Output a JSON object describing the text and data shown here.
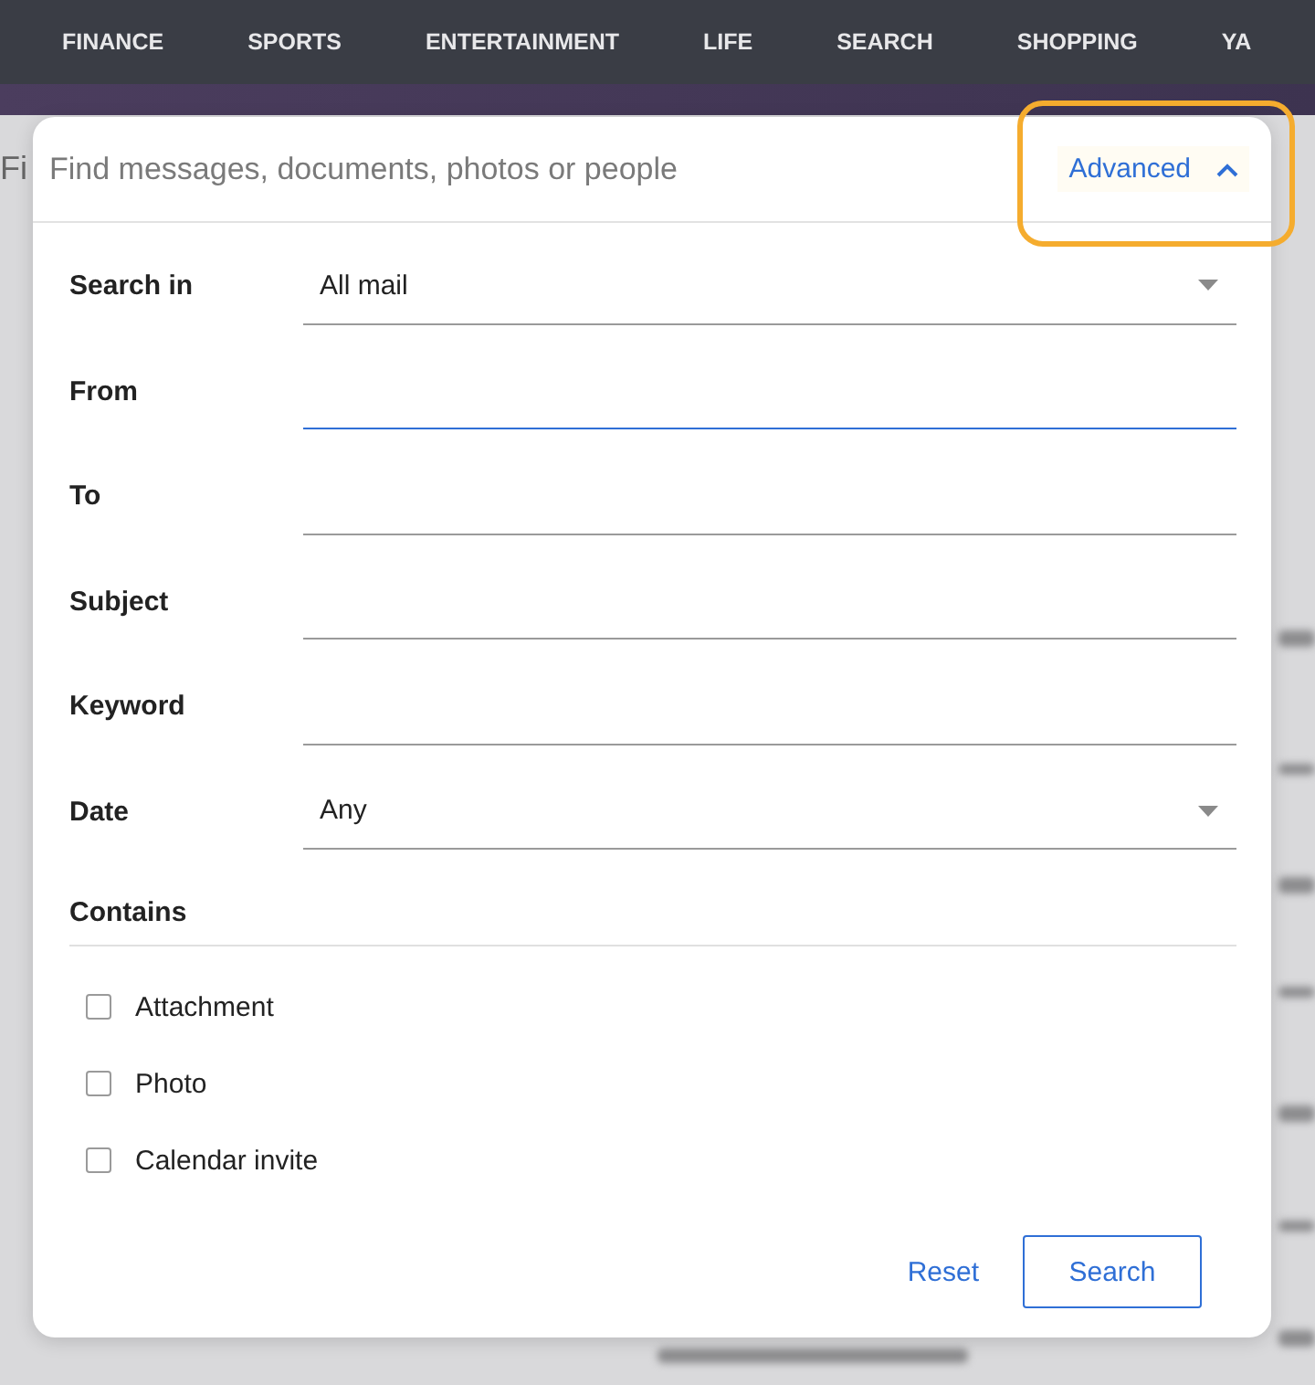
{
  "nav": {
    "items": [
      {
        "label": "FINANCE"
      },
      {
        "label": "SPORTS"
      },
      {
        "label": "ENTERTAINMENT"
      },
      {
        "label": "LIFE"
      },
      {
        "label": "SEARCH"
      },
      {
        "label": "SHOPPING"
      },
      {
        "label": "YA"
      }
    ]
  },
  "background": {
    "partial_text": "Fi"
  },
  "search": {
    "placeholder": "Find messages, documents, photos or people",
    "advanced": {
      "label": "Advanced",
      "expanded": true,
      "highlighted": true
    }
  },
  "fields": [
    {
      "kind": "select",
      "label": "Search in",
      "value": "All mail",
      "focused": false
    },
    {
      "kind": "text",
      "label": "From",
      "focused": true
    },
    {
      "kind": "text",
      "label": "To",
      "focused": false
    },
    {
      "kind": "text",
      "label": "Subject",
      "focused": false
    },
    {
      "kind": "text",
      "label": "Keyword",
      "focused": false
    },
    {
      "kind": "select",
      "label": "Date",
      "value": "Any",
      "focused": false
    }
  ],
  "contains": {
    "label": "Contains",
    "options": [
      {
        "label": "Attachment",
        "checked": false
      },
      {
        "label": "Photo",
        "checked": false
      },
      {
        "label": "Calendar invite",
        "checked": false
      }
    ]
  },
  "buttons": [
    {
      "kind": "text",
      "label": "Reset"
    },
    {
      "kind": "outlined",
      "label": "Search"
    }
  ]
}
